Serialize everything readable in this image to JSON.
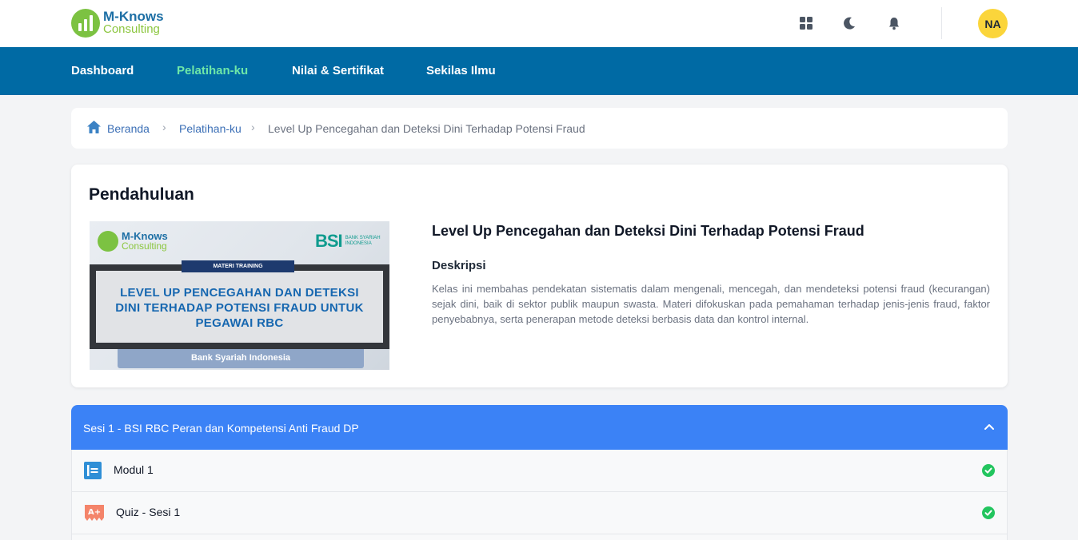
{
  "brand": {
    "name_line1": "M-Knows",
    "name_line2": "Consulting"
  },
  "header": {
    "icons": [
      "grid-icon",
      "moon-icon",
      "bell-icon"
    ],
    "avatar_initials": "NA"
  },
  "nav": {
    "items": [
      {
        "label": "Dashboard",
        "active": false
      },
      {
        "label": "Pelatihan-ku",
        "active": true
      },
      {
        "label": "Nilai & Sertifikat",
        "active": false
      },
      {
        "label": "Sekilas Ilmu",
        "active": false
      }
    ]
  },
  "breadcrumb": {
    "items": [
      {
        "label": "Beranda",
        "icon": "home-icon"
      },
      {
        "label": "Pelatihan-ku"
      },
      {
        "label": "Level Up Pencegahan dan Deteksi Dini Terhadap Potensi Fraud"
      }
    ]
  },
  "intro": {
    "section_title": "Pendahuluan",
    "thumbnail": {
      "brand_line1": "M-Knows",
      "brand_line2": "Consulting",
      "partner_short": "BSI",
      "partner_full_line1": "BANK SYARIAH",
      "partner_full_line2": "INDONESIA",
      "tag": "MATERI TRAINING",
      "headline_line1": "LEVEL UP PENCEGAHAN DAN DETEKSI",
      "headline_line2": "DINI TERHADAP POTENSI FRAUD UNTUK",
      "headline_line3": "PEGAWAI RBC",
      "footer": "Bank Syariah Indonesia"
    },
    "course_title": "Level Up Pencegahan dan Deteksi Dini Terhadap Potensi Fraud",
    "description_label": "Deskripsi",
    "description": "Kelas ini membahas pendekatan sistematis dalam mengenali, mencegah, dan mendeteksi potensi fraud (kecurangan) sejak dini, baik di sektor publik maupun swasta. Materi difokuskan pada pemahaman terhadap jenis-jenis fraud, faktor penyebabnya, serta penerapan metode deteksi berbasis data dan kontrol internal."
  },
  "session": {
    "title": "Sesi 1 - BSI RBC Peran dan Kompetensi Anti Fraud DP",
    "expanded": true,
    "items": [
      {
        "label": "Modul 1",
        "icon": "module-icon",
        "completed": true
      },
      {
        "label": "Quiz - Sesi 1",
        "icon": "quiz-icon",
        "completed": true
      }
    ]
  },
  "colors": {
    "nav_bg": "#006aa4",
    "nav_active": "#6ee7a8",
    "session_bg": "#3b82f6",
    "check": "#22c55e",
    "avatar": "#fbd53b"
  }
}
